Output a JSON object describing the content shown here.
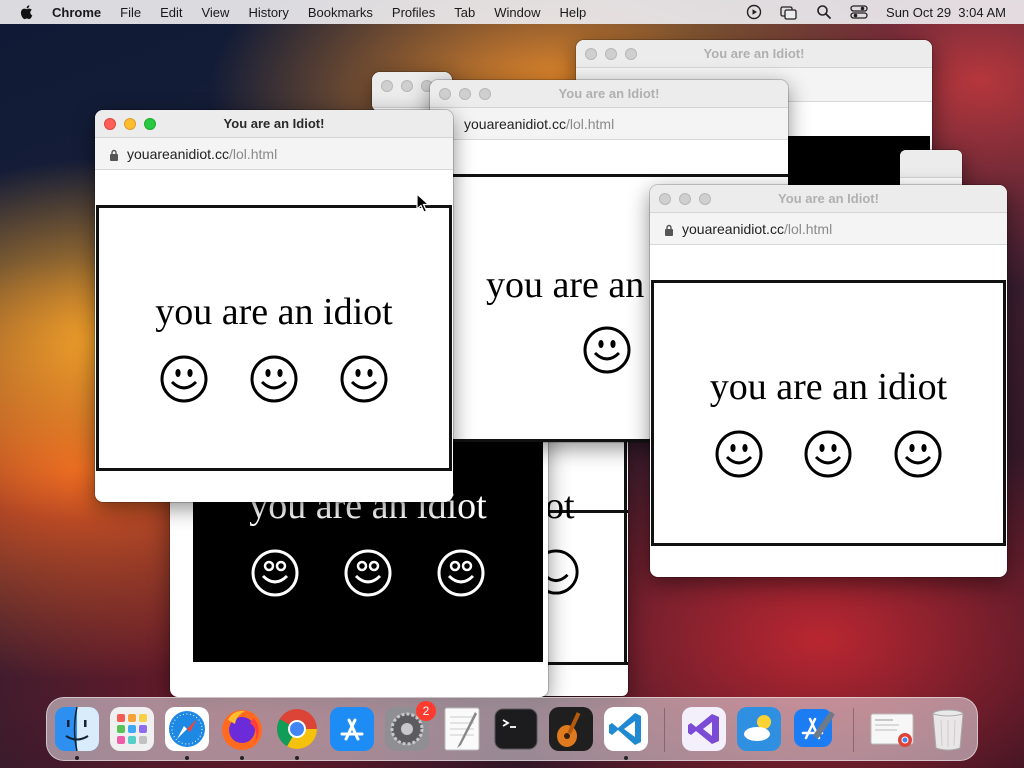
{
  "menubar": {
    "app_name": "Chrome",
    "items": [
      "File",
      "Edit",
      "View",
      "History",
      "Bookmarks",
      "Profiles",
      "Tab",
      "Window",
      "Help"
    ],
    "clock": "Sun Oct 29  3:04 AM",
    "status_icons": [
      "play-circle-icon",
      "screen-mirroring-icon",
      "search-icon",
      "control-center-icon"
    ]
  },
  "popup": {
    "title": "You are an Idiot!",
    "url_domain": "youareanidiot.cc",
    "url_path": "/lol.html",
    "message": "you are an idiot",
    "faces": [
      "smiley-icon",
      "smiley-icon",
      "smiley-icon"
    ]
  },
  "background_window_fragment": "ot",
  "dock": {
    "apps": [
      {
        "name": "Finder",
        "icon": "finder-icon",
        "running": true
      },
      {
        "name": "Launchpad",
        "icon": "launchpad-icon",
        "running": false
      },
      {
        "name": "Safari",
        "icon": "safari-icon",
        "running": true
      },
      {
        "name": "Firefox",
        "icon": "firefox-icon",
        "running": true
      },
      {
        "name": "Google Chrome",
        "icon": "chrome-icon",
        "running": true
      },
      {
        "name": "App Store",
        "icon": "app-store-icon",
        "running": false
      },
      {
        "name": "System Settings",
        "icon": "system-settings-icon",
        "running": false,
        "badge": "2"
      },
      {
        "name": "TextEdit",
        "icon": "textedit-icon",
        "running": false
      },
      {
        "name": "Terminal",
        "icon": "terminal-icon",
        "running": false
      },
      {
        "name": "GarageBand",
        "icon": "garageband-icon",
        "running": false
      },
      {
        "name": "Visual Studio Code",
        "icon": "vscode-icon",
        "running": true
      },
      {
        "name": "Visual Studio",
        "icon": "visual-studio-icon",
        "running": false
      },
      {
        "name": "Weather",
        "icon": "weather-icon",
        "running": false
      },
      {
        "name": "Xcode",
        "icon": "xcode-icon",
        "running": false
      },
      {
        "name": "Recent Document",
        "icon": "recent-document-icon",
        "running": false
      },
      {
        "name": "Trash",
        "icon": "trash-icon",
        "running": false
      }
    ]
  },
  "colors": {
    "close": "#ff5f57",
    "minimize": "#febc2e",
    "zoom": "#28c840",
    "url_path": "#8a8a8a",
    "badge": "#ff3b30"
  }
}
